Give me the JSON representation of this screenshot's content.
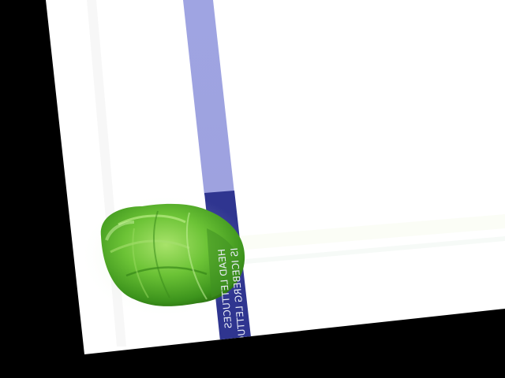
{
  "label": {
    "line1": "HEAD LETTUCES",
    "line2": "IS ICEBERG LETTUCE"
  },
  "colors": {
    "background": "#000000",
    "card": "#ffffff",
    "stripe_light": "#9fa4e2",
    "stripe_dark": "#2f3590",
    "lettuce_light": "#8fd650",
    "lettuce_mid": "#5cb82c",
    "lettuce_dark": "#2f7f14"
  },
  "icons": {
    "lettuce": "iceberg-lettuce-head"
  }
}
